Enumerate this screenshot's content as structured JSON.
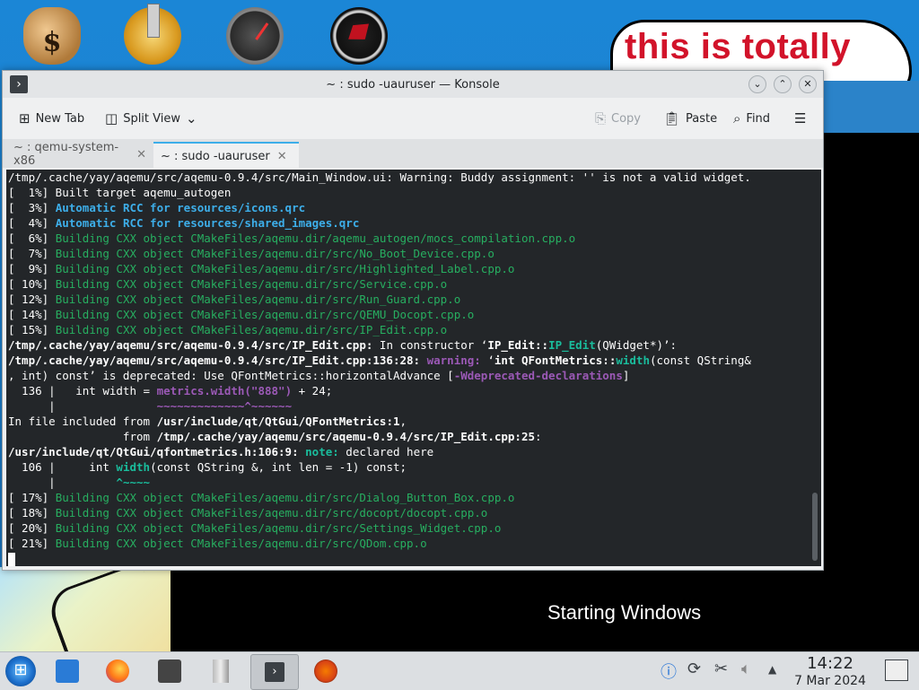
{
  "desktop": {
    "bubble_text": "this is totally",
    "starting_text": "Starting Windows"
  },
  "window": {
    "title": "~ : sudo -uauruser — Konsole"
  },
  "toolbar": {
    "new_tab": "New Tab",
    "split_view": "Split View",
    "copy": "Copy",
    "paste": "Paste",
    "find": "Find"
  },
  "tabs": [
    {
      "label": "~ : qemu-system-x86",
      "active": false
    },
    {
      "label": "~ : sudo -uauruser",
      "active": true
    }
  ],
  "terminal": {
    "lines": [
      [
        {
          "t": "/tmp/.cache/yay/aqemu/src/aqemu-0.9.4/src/Main_Window.ui: Warning: Buddy assignment: '' is not a valid widget.",
          "c": ""
        }
      ],
      [
        {
          "t": "[  1%] Built target aqemu_autogen",
          "c": ""
        }
      ],
      [
        {
          "t": "[  3%] ",
          "c": ""
        },
        {
          "t": "Automatic RCC for resources/icons.qrc",
          "c": "b"
        }
      ],
      [
        {
          "t": "[  4%] ",
          "c": ""
        },
        {
          "t": "Automatic RCC for resources/shared_images.qrc",
          "c": "b"
        }
      ],
      [
        {
          "t": "[  6%] ",
          "c": ""
        },
        {
          "t": "Building CXX object CMakeFiles/aqemu.dir/aqemu_autogen/mocs_compilation.cpp.o",
          "c": "g"
        }
      ],
      [
        {
          "t": "[  7%] ",
          "c": ""
        },
        {
          "t": "Building CXX object CMakeFiles/aqemu.dir/src/No_Boot_Device.cpp.o",
          "c": "g"
        }
      ],
      [
        {
          "t": "[  9%] ",
          "c": ""
        },
        {
          "t": "Building CXX object CMakeFiles/aqemu.dir/src/Highlighted_Label.cpp.o",
          "c": "g"
        }
      ],
      [
        {
          "t": "[ 10%] ",
          "c": ""
        },
        {
          "t": "Building CXX object CMakeFiles/aqemu.dir/src/Service.cpp.o",
          "c": "g"
        }
      ],
      [
        {
          "t": "[ 12%] ",
          "c": ""
        },
        {
          "t": "Building CXX object CMakeFiles/aqemu.dir/src/Run_Guard.cpp.o",
          "c": "g"
        }
      ],
      [
        {
          "t": "[ 14%] ",
          "c": ""
        },
        {
          "t": "Building CXX object CMakeFiles/aqemu.dir/src/QEMU_Docopt.cpp.o",
          "c": "g"
        }
      ],
      [
        {
          "t": "[ 15%] ",
          "c": ""
        },
        {
          "t": "Building CXX object CMakeFiles/aqemu.dir/src/IP_Edit.cpp.o",
          "c": "g"
        }
      ],
      [
        {
          "t": "/tmp/.cache/yay/aqemu/src/aqemu-0.9.4/src/IP_Edit.cpp:",
          "c": "w"
        },
        {
          "t": " In constructor ‘",
          "c": ""
        },
        {
          "t": "IP_Edit::",
          "c": "w"
        },
        {
          "t": "IP_Edit",
          "c": "cyan"
        },
        {
          "t": "(QWidget*)’:",
          "c": ""
        }
      ],
      [
        {
          "t": "/tmp/.cache/yay/aqemu/src/aqemu-0.9.4/src/IP_Edit.cpp:136:28:",
          "c": "w"
        },
        {
          "t": " ",
          "c": ""
        },
        {
          "t": "warning:",
          "c": "p"
        },
        {
          "t": " ‘",
          "c": ""
        },
        {
          "t": "int QFontMetrics::",
          "c": "w"
        },
        {
          "t": "width",
          "c": "cyan"
        },
        {
          "t": "(const QString&",
          "c": ""
        }
      ],
      [
        {
          "t": ", int) const’ is deprecated: Use QFontMetrics::horizontalAdvance [",
          "c": ""
        },
        {
          "t": "-Wdeprecated-declarations",
          "c": "p"
        },
        {
          "t": "]",
          "c": ""
        }
      ],
      [
        {
          "t": "  136 |   int width = ",
          "c": ""
        },
        {
          "t": "metrics.width(\"888\")",
          "c": "p"
        },
        {
          "t": " + 24;",
          "c": ""
        }
      ],
      [
        {
          "t": "      |               ",
          "c": ""
        },
        {
          "t": "~~~~~~~~~~~~~^~~~~~~",
          "c": "p"
        }
      ],
      [
        {
          "t": "In file included from ",
          "c": ""
        },
        {
          "t": "/usr/include/qt/QtGui/QFontMetrics:1",
          "c": "w"
        },
        {
          "t": ",",
          "c": ""
        }
      ],
      [
        {
          "t": "                 from ",
          "c": ""
        },
        {
          "t": "/tmp/.cache/yay/aqemu/src/aqemu-0.9.4/src/IP_Edit.cpp:25",
          "c": "w"
        },
        {
          "t": ":",
          "c": ""
        }
      ],
      [
        {
          "t": "/usr/include/qt/QtGui/qfontmetrics.h:106:9:",
          "c": "w"
        },
        {
          "t": " ",
          "c": ""
        },
        {
          "t": "note:",
          "c": "cyan"
        },
        {
          "t": " declared here",
          "c": ""
        }
      ],
      [
        {
          "t": "  106 |     int ",
          "c": ""
        },
        {
          "t": "width",
          "c": "cyan"
        },
        {
          "t": "(const QString &, int len = -1) const;",
          "c": ""
        }
      ],
      [
        {
          "t": "      |         ",
          "c": ""
        },
        {
          "t": "^~~~~",
          "c": "cyan"
        }
      ],
      [
        {
          "t": "[ 17%] ",
          "c": ""
        },
        {
          "t": "Building CXX object CMakeFiles/aqemu.dir/src/Dialog_Button_Box.cpp.o",
          "c": "g"
        }
      ],
      [
        {
          "t": "[ 18%] ",
          "c": ""
        },
        {
          "t": "Building CXX object CMakeFiles/aqemu.dir/src/docopt/docopt.cpp.o",
          "c": "g"
        }
      ],
      [
        {
          "t": "[ 20%] ",
          "c": ""
        },
        {
          "t": "Building CXX object CMakeFiles/aqemu.dir/src/Settings_Widget.cpp.o",
          "c": "g"
        }
      ],
      [
        {
          "t": "[ 21%] ",
          "c": ""
        },
        {
          "t": "Building CXX object CMakeFiles/aqemu.dir/src/QDom.cpp.o",
          "c": "g"
        }
      ]
    ]
  },
  "taskbar": {
    "time": "14:22",
    "date": "7 Mar 2024"
  }
}
